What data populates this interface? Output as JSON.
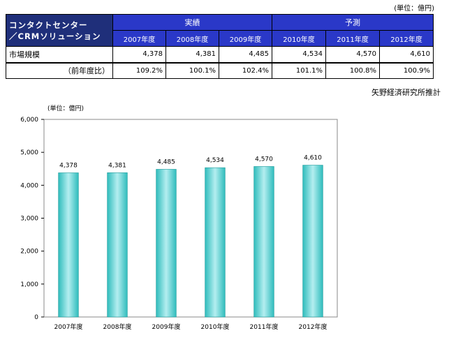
{
  "unit_top": "(単位：億円)",
  "table": {
    "corner_line1": "コンタクトセンター",
    "corner_line2": "／CRMソリューション",
    "group_actual": "実績",
    "group_forecast": "予測",
    "years": [
      "2007年度",
      "2008年度",
      "2009年度",
      "2010年度",
      "2011年度",
      "2012年度"
    ],
    "row1_label": "市場規模",
    "row1_values": [
      "4,378",
      "4,381",
      "4,485",
      "4,534",
      "4,570",
      "4,610"
    ],
    "row2_label": "（前年度比）",
    "row2_values": [
      "109.2%",
      "100.1%",
      "102.4%",
      "101.1%",
      "100.8%",
      "100.9%"
    ]
  },
  "source_note": "矢野経済研究所推計",
  "chart_data": {
    "type": "bar",
    "unit_label": "(単位：億円)",
    "categories": [
      "2007年度",
      "2008年度",
      "2009年度",
      "2010年度",
      "2011年度",
      "2012年度"
    ],
    "values": [
      4378,
      4381,
      4485,
      4534,
      4570,
      4610
    ],
    "data_labels": [
      "4,378",
      "4,381",
      "4,485",
      "4,534",
      "4,570",
      "4,610"
    ],
    "ylim": [
      0,
      6000
    ],
    "yticks": [
      0,
      1000,
      2000,
      3000,
      4000,
      5000,
      6000
    ],
    "ytick_labels": [
      "0",
      "1,000",
      "2,000",
      "3,000",
      "4,000",
      "5,000",
      "6,000"
    ],
    "bar_color": "#3cc8c8",
    "legend": "none",
    "grid": false
  }
}
